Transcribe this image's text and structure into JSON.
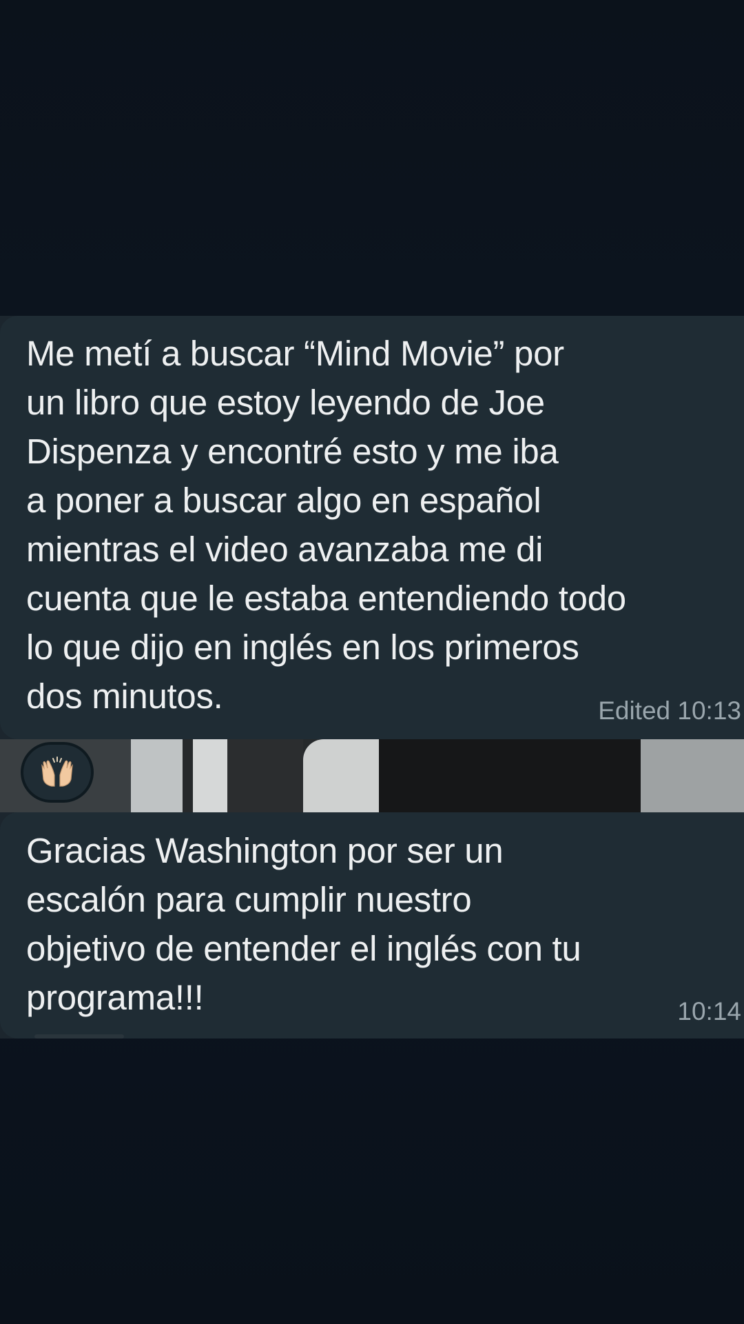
{
  "messages": [
    {
      "text": "Me metí a buscar “Mind Movie” por\nun libro que estoy leyendo de Joe\nDispenza y encontré esto y me iba\na poner a buscar algo en español\nmientras el video avanzaba me di\ncuenta que le estaba entendiendo todo\nlo que dijo en inglés en los primeros\ndos minutos.",
      "meta": "Edited 10:13"
    },
    {
      "text": "Gracias Washington por ser un\nescalón para cumplir nuestro\nobjetivo de entender el inglés con tu\nprograma!!!",
      "meta": "10:14"
    }
  ],
  "reaction": {
    "icon": "raising-hands-icon"
  },
  "colors": {
    "bubble": "#1f2c34",
    "background": "#0b121b",
    "text": "#eef0f1",
    "meta": "#9aa6ad"
  }
}
